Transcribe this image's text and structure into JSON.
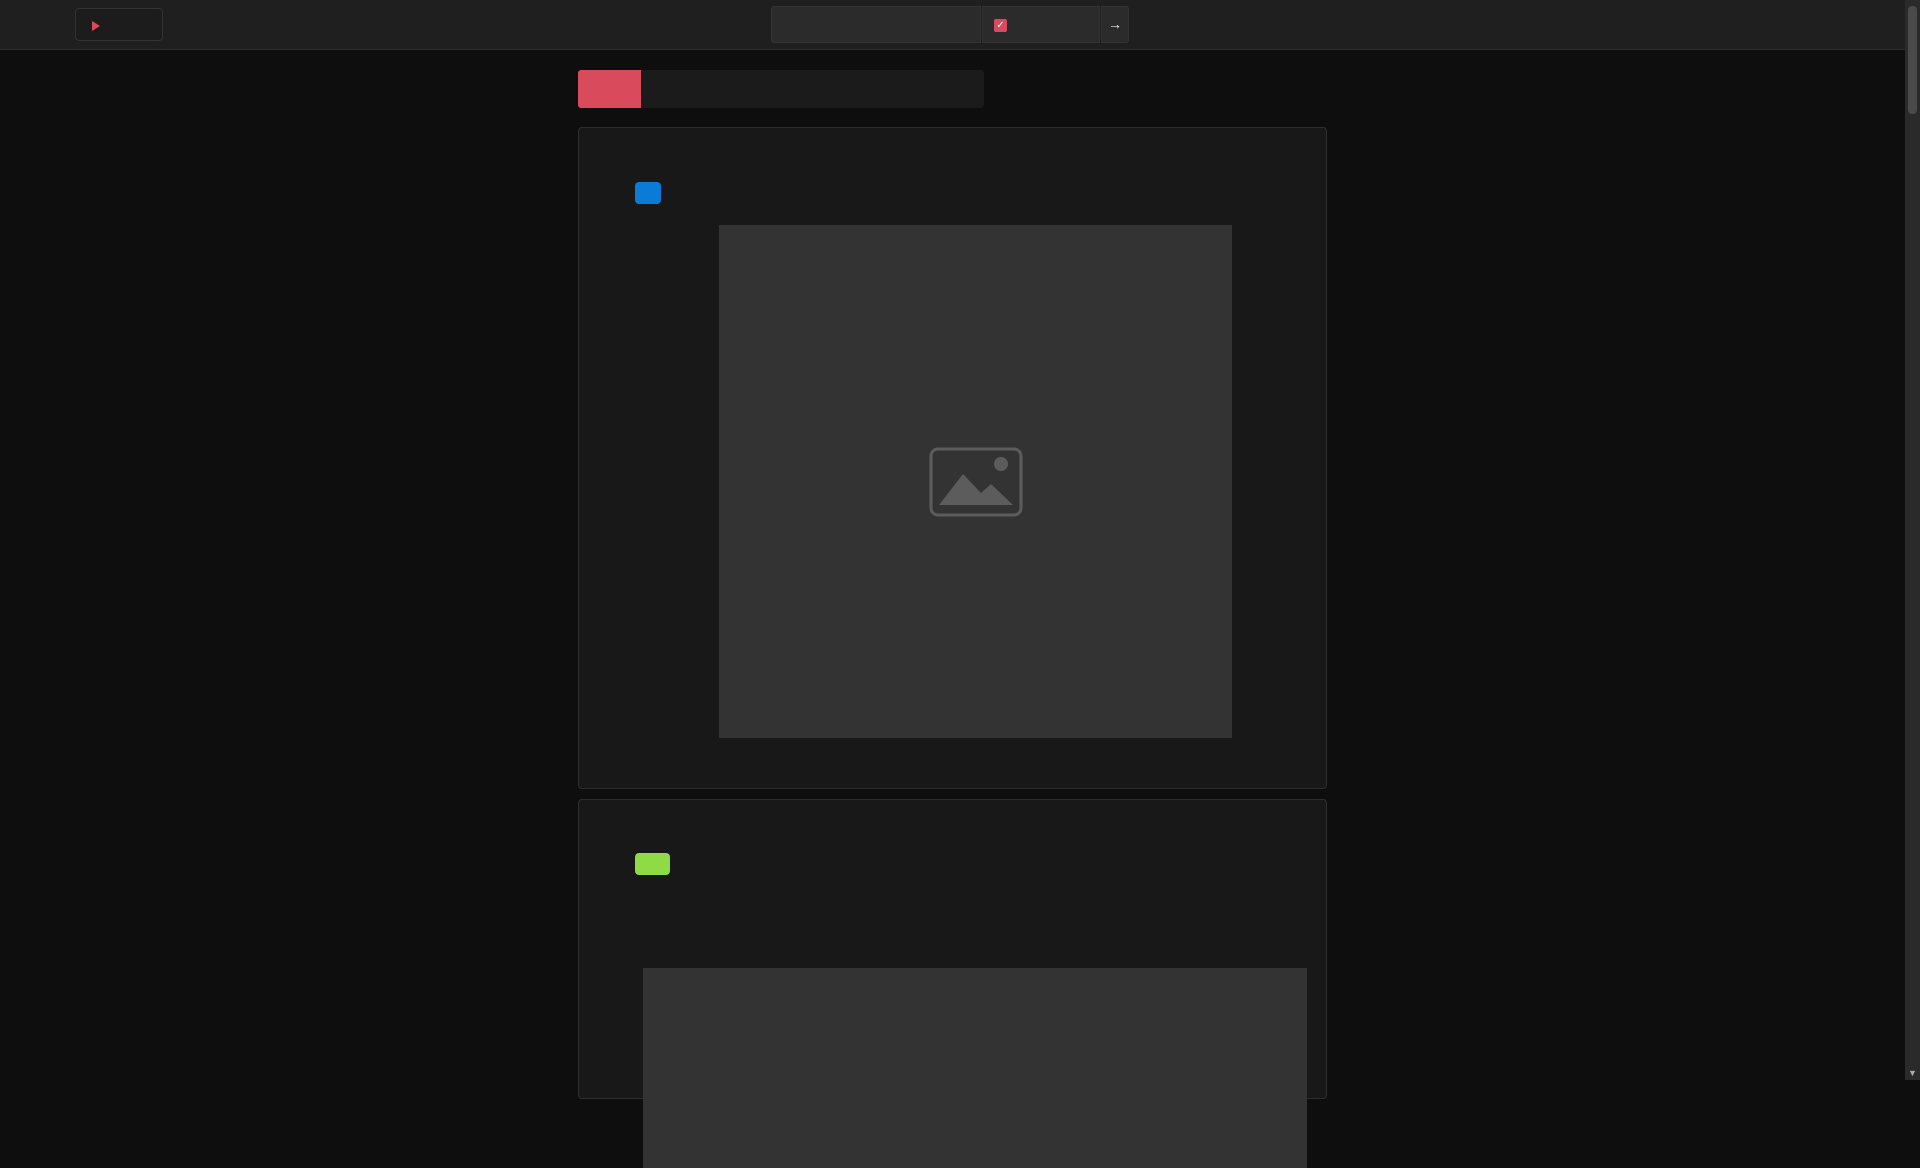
{
  "header": {
    "logo_icon": "play-icon",
    "search": {
      "value": "",
      "placeholder": ""
    },
    "filter": {
      "checked": true,
      "icon": "checkbox-checked-icon"
    },
    "go_icon": "arrow-right-icon"
  },
  "tabs": {
    "active_index": 0,
    "accent_color": "#d94a5c"
  },
  "cards": [
    {
      "badge_color": "#0a7bd6",
      "media": "image-placeholder-icon"
    },
    {
      "badge_color": "#8edb46",
      "media": "image-placeholder"
    }
  ],
  "colors": {
    "background": "#0e0e0e",
    "topbar": "#1f1f1f",
    "card": "#181818",
    "accent": "#d94a5c"
  }
}
